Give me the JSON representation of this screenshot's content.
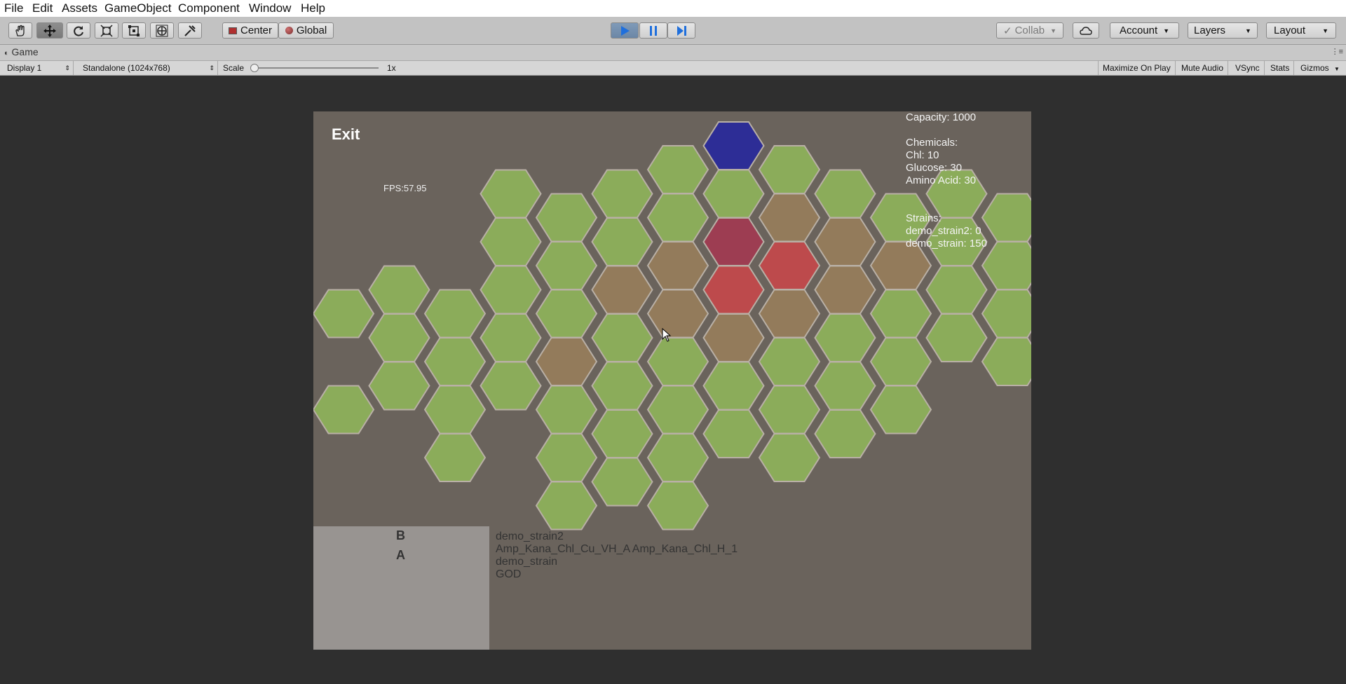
{
  "menu": [
    "File",
    "Edit",
    "Assets",
    "GameObject",
    "Component",
    "Window",
    "Help"
  ],
  "toolbar": {
    "tools": [
      {
        "name": "hand-tool",
        "icon": "hand-icon"
      },
      {
        "name": "move-tool",
        "icon": "move-icon"
      },
      {
        "name": "rotate-tool",
        "icon": "rotate-icon"
      },
      {
        "name": "scale-tool",
        "icon": "scale-icon"
      },
      {
        "name": "rect-tool",
        "icon": "rect-icon"
      },
      {
        "name": "transform-tool",
        "icon": "transform-icon"
      },
      {
        "name": "custom-tool",
        "icon": "tools-icon"
      }
    ],
    "pivot_mode": "Center",
    "pivot_rotation": "Global",
    "play_icon": "play-icon",
    "pause_icon": "pause-icon",
    "step_icon": "step-icon",
    "collab": "Collab",
    "account": "Account",
    "layers": "Layers",
    "layout": "Layout"
  },
  "panel": {
    "tab_label": "Game"
  },
  "game_bar": {
    "display": "Display 1",
    "resolution": "Standalone (1024x768)",
    "scale_label": "Scale",
    "scale_value": "1x",
    "buttons": [
      "Maximize On Play",
      "Mute Audio",
      "VSync",
      "Stats",
      "Gizmos"
    ]
  },
  "game": {
    "exit_label": "Exit",
    "fps": "FPS:57.95",
    "capacity": "Capacity: 1000",
    "chemicals_header": "Chemicals:",
    "chemicals": [
      "Chl: 10",
      "Glucose: 30",
      "Amino Acid: 30"
    ],
    "strains_header": "Strains:",
    "strains": [
      "demo_strain2: 0",
      "demo_strain: 150"
    ],
    "slots": [
      "B",
      "A"
    ],
    "strain_list": [
      "demo_strain2",
      "Amp_Kana_Chl_Cu_VH_A  Amp_Kana_Chl_H_1",
      "demo_strain",
      "GOD"
    ]
  },
  "colors": {
    "green": "#8bac5a",
    "brown": "#937b5b",
    "red": "#bd4a4c",
    "purple_red": "#9d3d52",
    "blue": "#2d2d96",
    "background": "#6a635c",
    "hex_stroke": "#b9b0a6"
  },
  "hexgrid": {
    "cells": [
      {
        "col": 0,
        "row": 3,
        "state": "green"
      },
      {
        "col": 0,
        "row": 5,
        "state": "green"
      },
      {
        "col": 1,
        "row": 3,
        "state": "green"
      },
      {
        "col": 1,
        "row": 4,
        "state": "green"
      },
      {
        "col": 1,
        "row": 5,
        "state": "green"
      },
      {
        "col": 2,
        "row": 3,
        "state": "green"
      },
      {
        "col": 2,
        "row": 4,
        "state": "green"
      },
      {
        "col": 2,
        "row": 5,
        "state": "green"
      },
      {
        "col": 2,
        "row": 6,
        "state": "green"
      },
      {
        "col": 3,
        "row": 1,
        "state": "green"
      },
      {
        "col": 3,
        "row": 2,
        "state": "green"
      },
      {
        "col": 3,
        "row": 3,
        "state": "green"
      },
      {
        "col": 3,
        "row": 4,
        "state": "green"
      },
      {
        "col": 3,
        "row": 5,
        "state": "green"
      },
      {
        "col": 4,
        "row": 1,
        "state": "green"
      },
      {
        "col": 4,
        "row": 2,
        "state": "green"
      },
      {
        "col": 4,
        "row": 3,
        "state": "green"
      },
      {
        "col": 4,
        "row": 4,
        "state": "brown"
      },
      {
        "col": 4,
        "row": 5,
        "state": "green"
      },
      {
        "col": 4,
        "row": 6,
        "state": "green"
      },
      {
        "col": 4,
        "row": 7,
        "state": "green"
      },
      {
        "col": 5,
        "row": 1,
        "state": "green"
      },
      {
        "col": 5,
        "row": 2,
        "state": "green"
      },
      {
        "col": 5,
        "row": 3,
        "state": "brown"
      },
      {
        "col": 5,
        "row": 4,
        "state": "green"
      },
      {
        "col": 5,
        "row": 5,
        "state": "green"
      },
      {
        "col": 5,
        "row": 6,
        "state": "green"
      },
      {
        "col": 5,
        "row": 7,
        "state": "green"
      },
      {
        "col": 6,
        "row": 0,
        "state": "green"
      },
      {
        "col": 6,
        "row": 1,
        "state": "green"
      },
      {
        "col": 6,
        "row": 2,
        "state": "brown"
      },
      {
        "col": 6,
        "row": 3,
        "state": "brown"
      },
      {
        "col": 6,
        "row": 4,
        "state": "green"
      },
      {
        "col": 6,
        "row": 5,
        "state": "green"
      },
      {
        "col": 6,
        "row": 6,
        "state": "green"
      },
      {
        "col": 6,
        "row": 7,
        "state": "green"
      },
      {
        "col": 7,
        "row": 0,
        "state": "blue"
      },
      {
        "col": 7,
        "row": 1,
        "state": "green"
      },
      {
        "col": 7,
        "row": 2,
        "state": "purple_red"
      },
      {
        "col": 7,
        "row": 3,
        "state": "red"
      },
      {
        "col": 7,
        "row": 4,
        "state": "brown"
      },
      {
        "col": 7,
        "row": 5,
        "state": "green"
      },
      {
        "col": 7,
        "row": 6,
        "state": "green"
      },
      {
        "col": 8,
        "row": 0,
        "state": "green"
      },
      {
        "col": 8,
        "row": 1,
        "state": "brown"
      },
      {
        "col": 8,
        "row": 2,
        "state": "red"
      },
      {
        "col": 8,
        "row": 3,
        "state": "brown"
      },
      {
        "col": 8,
        "row": 4,
        "state": "green"
      },
      {
        "col": 8,
        "row": 5,
        "state": "green"
      },
      {
        "col": 8,
        "row": 6,
        "state": "green"
      },
      {
        "col": 9,
        "row": 1,
        "state": "green"
      },
      {
        "col": 9,
        "row": 2,
        "state": "brown"
      },
      {
        "col": 9,
        "row": 3,
        "state": "brown"
      },
      {
        "col": 9,
        "row": 4,
        "state": "green"
      },
      {
        "col": 9,
        "row": 5,
        "state": "green"
      },
      {
        "col": 9,
        "row": 6,
        "state": "green"
      },
      {
        "col": 10,
        "row": 1,
        "state": "green"
      },
      {
        "col": 10,
        "row": 2,
        "state": "brown"
      },
      {
        "col": 10,
        "row": 3,
        "state": "green"
      },
      {
        "col": 10,
        "row": 4,
        "state": "green"
      },
      {
        "col": 10,
        "row": 5,
        "state": "green"
      },
      {
        "col": 11,
        "row": 1,
        "state": "green"
      },
      {
        "col": 11,
        "row": 2,
        "state": "green"
      },
      {
        "col": 11,
        "row": 3,
        "state": "green"
      },
      {
        "col": 11,
        "row": 4,
        "state": "green"
      },
      {
        "col": 12,
        "row": 1,
        "state": "green"
      },
      {
        "col": 12,
        "row": 2,
        "state": "green"
      },
      {
        "col": 12,
        "row": 3,
        "state": "green"
      },
      {
        "col": 12,
        "row": 4,
        "state": "green"
      },
      {
        "col": 13,
        "row": 1,
        "state": "green"
      },
      {
        "col": 13,
        "row": 2,
        "state": "green"
      },
      {
        "col": 13,
        "row": 3,
        "state": "green"
      }
    ]
  }
}
